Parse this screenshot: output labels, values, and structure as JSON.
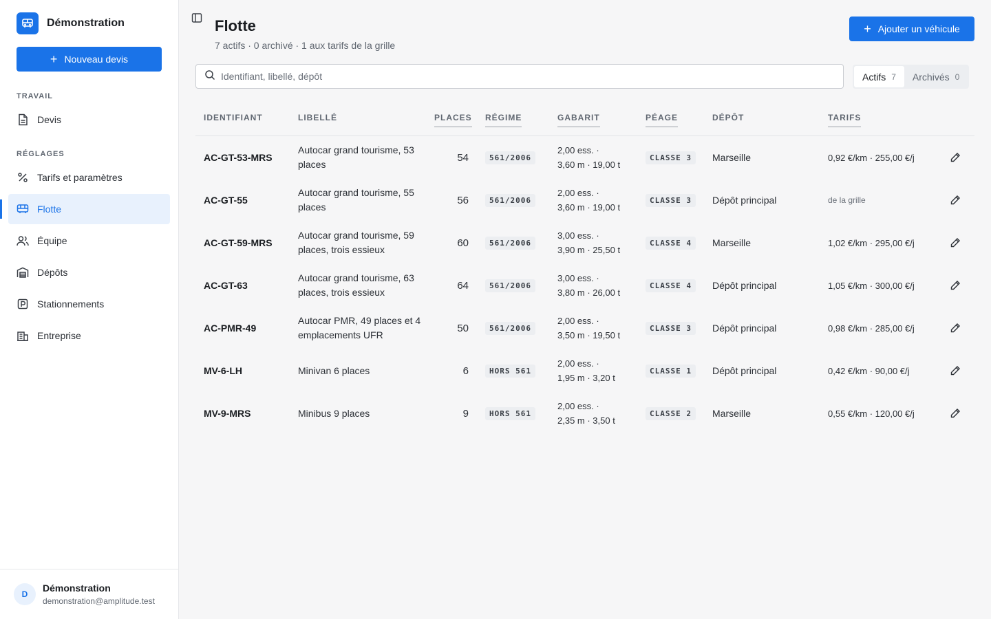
{
  "sidebar": {
    "brand": "Démonstration",
    "new_quote": "Nouveau devis",
    "sections": [
      {
        "label": "TRAVAIL"
      },
      {
        "label": "RÉGLAGES"
      }
    ],
    "items": [
      {
        "label": "Devis",
        "icon": "document-icon"
      },
      {
        "label": "Tarifs et paramètres",
        "icon": "percent-icon"
      },
      {
        "label": "Flotte",
        "icon": "bus-icon",
        "active": true
      },
      {
        "label": "Équipe",
        "icon": "users-icon"
      },
      {
        "label": "Dépôts",
        "icon": "warehouse-icon"
      },
      {
        "label": "Stationnements",
        "icon": "parking-icon"
      },
      {
        "label": "Entreprise",
        "icon": "building-icon"
      }
    ],
    "user": {
      "initial": "D",
      "name": "Démonstration",
      "email": "demonstration@amplitude.test"
    }
  },
  "header": {
    "title": "Flotte",
    "subtitle": "7 actifs · 0 archivé · 1 aux tarifs de la grille",
    "add_button": "Ajouter un véhicule"
  },
  "search": {
    "placeholder": "Identifiant, libellé, dépôt",
    "value": ""
  },
  "filters": [
    {
      "label": "Actifs",
      "count": "7",
      "active": true
    },
    {
      "label": "Archivés",
      "count": "0",
      "active": false
    }
  ],
  "table": {
    "columns": [
      "IDENTIFIANT",
      "LIBELLÉ",
      "PLACES",
      "RÉGIME",
      "GABARIT",
      "PÉAGE",
      "DÉPÔT",
      "TARIFS"
    ],
    "rows": [
      {
        "id": "AC-GT-53-MRS",
        "libelle": "Autocar grand tourisme, 53 places",
        "places": "54",
        "regime": "561/2006",
        "gabarit_1": "2,00 ess. ·",
        "gabarit_2": "3,60 m · 19,00 t",
        "peage": "CLASSE 3",
        "depot": "Marseille",
        "tarifs": "0,92 €/km · 255,00 €/j"
      },
      {
        "id": "AC-GT-55",
        "libelle": "Autocar grand tourisme, 55 places",
        "places": "56",
        "regime": "561/2006",
        "gabarit_1": "2,00 ess. ·",
        "gabarit_2": "3,60 m · 19,00 t",
        "peage": "CLASSE 3",
        "depot": "Dépôt principal",
        "tarifs": "de la grille"
      },
      {
        "id": "AC-GT-59-MRS",
        "libelle": "Autocar grand tourisme, 59 places, trois essieux",
        "places": "60",
        "regime": "561/2006",
        "gabarit_1": "3,00 ess. ·",
        "gabarit_2": "3,90 m · 25,50 t",
        "peage": "CLASSE 4",
        "depot": "Marseille",
        "tarifs": "1,02 €/km · 295,00 €/j"
      },
      {
        "id": "AC-GT-63",
        "libelle": "Autocar grand tourisme, 63 places, trois essieux",
        "places": "64",
        "regime": "561/2006",
        "gabarit_1": "3,00 ess. ·",
        "gabarit_2": "3,80 m · 26,00 t",
        "peage": "CLASSE 4",
        "depot": "Dépôt principal",
        "tarifs": "1,05 €/km · 300,00 €/j"
      },
      {
        "id": "AC-PMR-49",
        "libelle": "Autocar PMR, 49 places et 4 emplacements UFR",
        "places": "50",
        "regime": "561/2006",
        "gabarit_1": "2,00 ess. ·",
        "gabarit_2": "3,50 m · 19,50 t",
        "peage": "CLASSE 3",
        "depot": "Dépôt principal",
        "tarifs": "0,98 €/km · 285,00 €/j"
      },
      {
        "id": "MV-6-LH",
        "libelle": "Minivan 6 places",
        "places": "6",
        "regime": "HORS 561",
        "gabarit_1": "2,00 ess. ·",
        "gabarit_2": "1,95 m · 3,20 t",
        "peage": "CLASSE 1",
        "depot": "Dépôt principal",
        "tarifs": "0,42 €/km · 90,00 €/j"
      },
      {
        "id": "MV-9-MRS",
        "libelle": "Minibus 9 places",
        "places": "9",
        "regime": "HORS 561",
        "gabarit_1": "2,00 ess. ·",
        "gabarit_2": "2,35 m · 3,50 t",
        "peage": "CLASSE 2",
        "depot": "Marseille",
        "tarifs": "0,55 €/km · 120,00 €/j"
      }
    ]
  },
  "colors": {
    "accent": "#1a73e8",
    "active_bg": "#e8f1fd"
  }
}
